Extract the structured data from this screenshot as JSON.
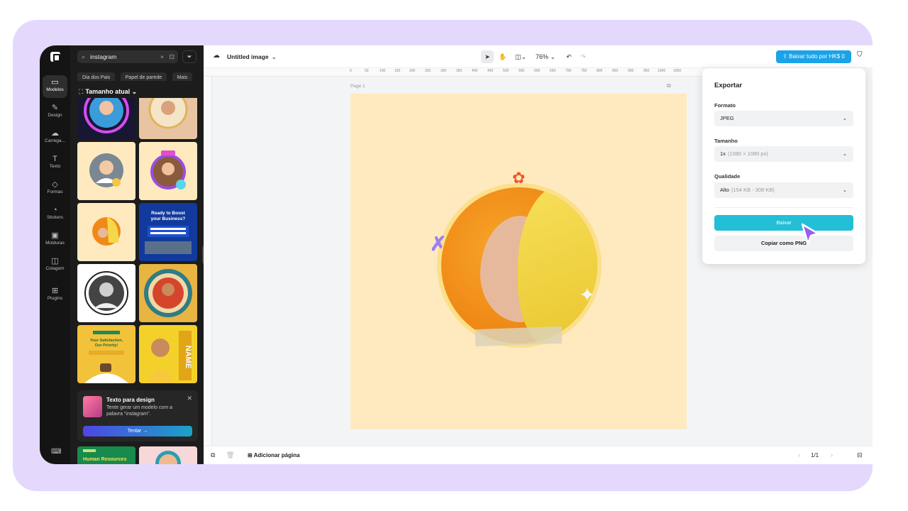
{
  "rail": {
    "items": [
      {
        "label": "Modelos",
        "icon": "templates-icon"
      },
      {
        "label": "Design",
        "icon": "design-icon"
      },
      {
        "label": "Carrega...",
        "icon": "upload-icon"
      },
      {
        "label": "Texto",
        "icon": "text-icon"
      },
      {
        "label": "Formas",
        "icon": "shapes-icon"
      },
      {
        "label": "Stickers",
        "icon": "stickers-icon"
      },
      {
        "label": "Molduras",
        "icon": "frames-icon"
      },
      {
        "label": "Colagem",
        "icon": "collage-icon"
      },
      {
        "label": "Plugins",
        "icon": "plugins-icon"
      }
    ]
  },
  "panel": {
    "search_value": "instagram",
    "chips": [
      "Dia dos Pais",
      "Papel de parede",
      "Mais"
    ],
    "size_label": "Tamanho atual",
    "promo": {
      "title": "Texto para design",
      "desc": "Tente gerar um modelo com a palavra \"instagram\".",
      "button": "Tentar →"
    }
  },
  "topbar": {
    "title": "Untitled image",
    "zoom": "76%",
    "export_label": "Baixar tudo por HK$ 0"
  },
  "ruler": {
    "ticks": [
      "0",
      "50",
      "100",
      "150",
      "200",
      "250",
      "300",
      "350",
      "400",
      "450",
      "500",
      "550",
      "600",
      "650",
      "700",
      "750",
      "800",
      "850",
      "900",
      "950",
      "1000",
      "1050"
    ]
  },
  "canvas": {
    "page_label": "Page 1"
  },
  "export_panel": {
    "title": "Exportar",
    "format_label": "Formato",
    "format_value": "JPEG",
    "size_label": "Tamanho",
    "size_value": "1x",
    "size_hint": "(1080 × 1080 px)",
    "quality_label": "Qualidade",
    "quality_value": "Alto",
    "quality_hint": "(154 KB - 308 KB)",
    "download_label": "Baixar",
    "copy_label": "Copiar como PNG"
  },
  "bottombar": {
    "add_page": "Adicionar página",
    "pager": "1/1"
  },
  "colors": {
    "accent": "#1aa3e8",
    "download": "#22bfd6",
    "frame": "#e4d9fc",
    "artboard": "#ffe9bf"
  }
}
